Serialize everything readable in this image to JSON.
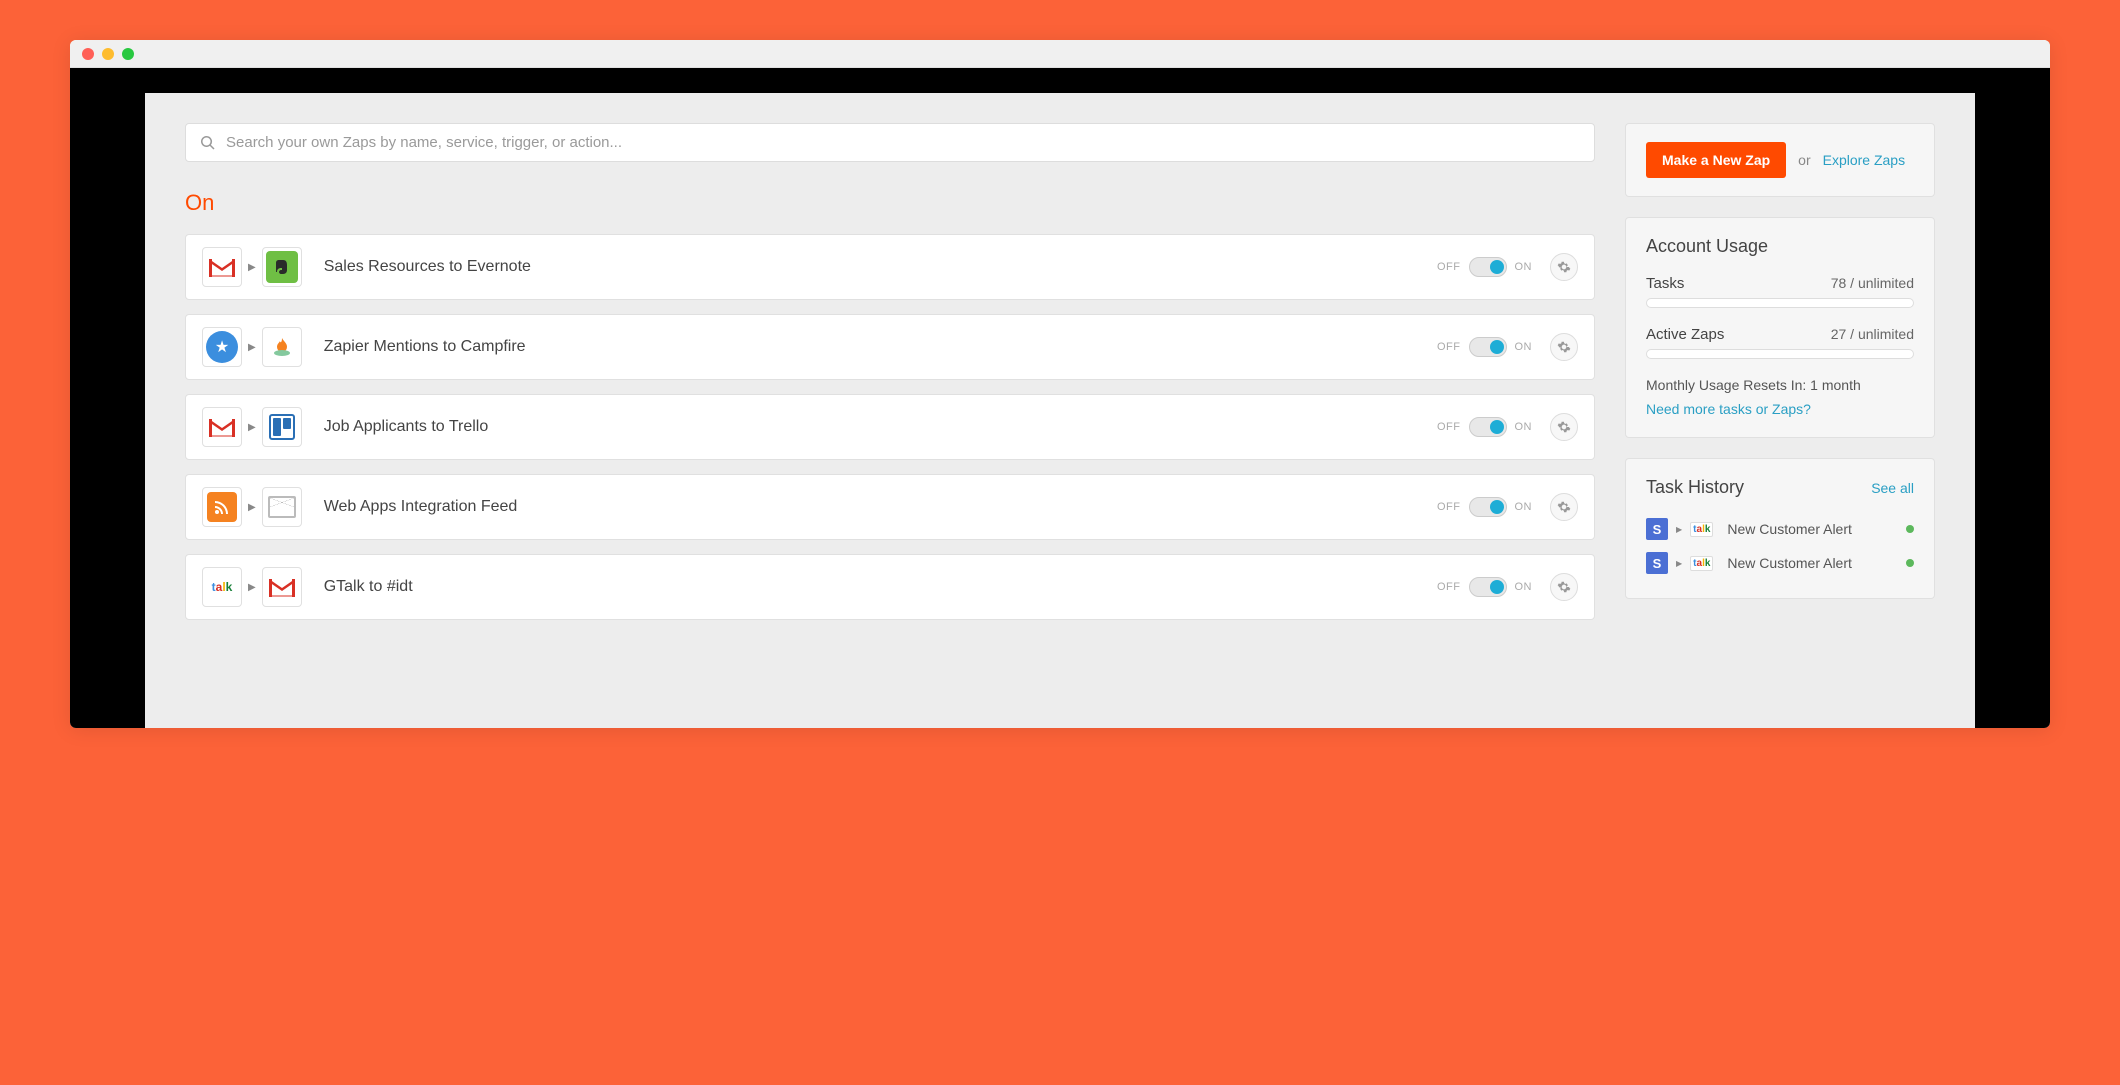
{
  "search": {
    "placeholder": "Search your own Zaps by name, service, trigger, or action..."
  },
  "section_on": "On",
  "zaps": [
    {
      "from_icon": "gmail",
      "to_icon": "evernote",
      "name": "Sales Resources to Evernote",
      "off": "OFF",
      "on": "ON"
    },
    {
      "from_icon": "star",
      "to_icon": "campfire",
      "name": "Zapier Mentions to Campfire",
      "off": "OFF",
      "on": "ON"
    },
    {
      "from_icon": "gmail",
      "to_icon": "trello",
      "name": "Job Applicants to Trello",
      "off": "OFF",
      "on": "ON"
    },
    {
      "from_icon": "rss",
      "to_icon": "envelope",
      "name": "Web Apps Integration Feed",
      "off": "OFF",
      "on": "ON"
    },
    {
      "from_icon": "talk",
      "to_icon": "gmail",
      "name": "GTalk to #idt",
      "off": "OFF",
      "on": "ON"
    }
  ],
  "cta": {
    "new_zap": "Make a New Zap",
    "or": "or",
    "explore": "Explore Zaps"
  },
  "usage": {
    "heading": "Account Usage",
    "tasks_label": "Tasks",
    "tasks_value": "78 / unlimited",
    "zaps_label": "Active Zaps",
    "zaps_value": "27 / unlimited",
    "reset": "Monthly Usage Resets In: 1 month",
    "need_more": "Need more tasks or Zaps?"
  },
  "history": {
    "heading": "Task History",
    "see_all": "See all",
    "items": [
      {
        "name": "New Customer Alert"
      },
      {
        "name": "New Customer Alert"
      }
    ]
  }
}
